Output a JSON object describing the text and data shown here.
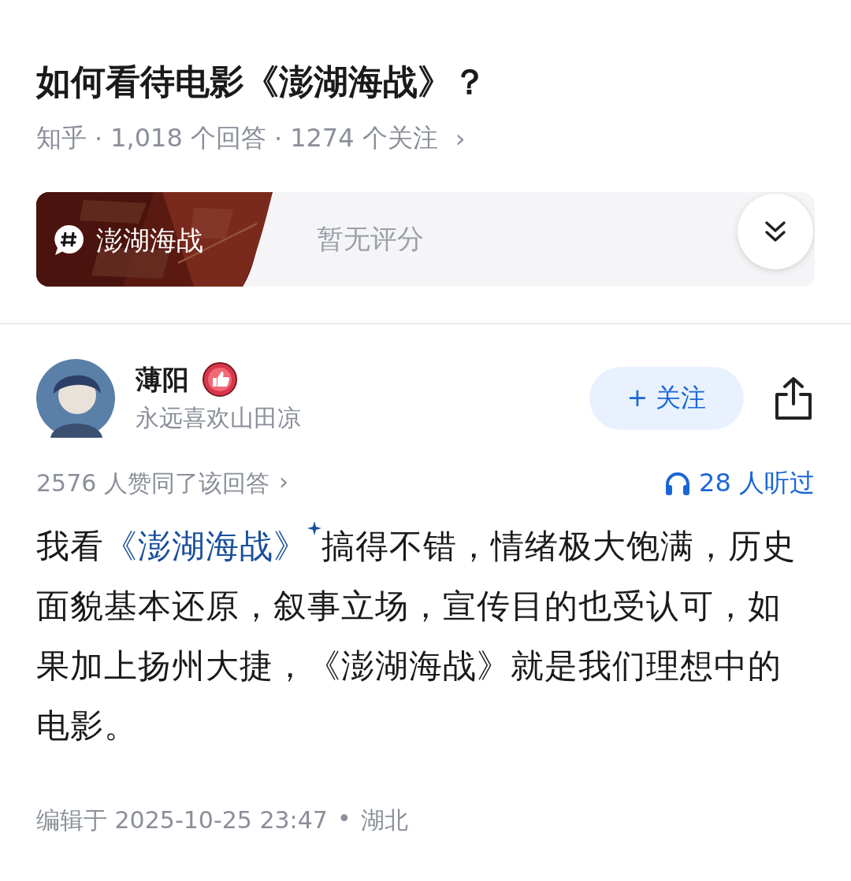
{
  "question": {
    "title": "如何看待电影《澎湖海战》？",
    "source": "知乎",
    "answers": "1,018 个回答",
    "followers": "1274 个关注",
    "chevron": "›",
    "separator": "·"
  },
  "topic_card": {
    "topic": "澎湖海战",
    "rating": "暂无评分"
  },
  "answer": {
    "author": {
      "name": "薄阳",
      "bio": "永远喜欢山田凉"
    },
    "follow_button": "+ 关注",
    "upvotes": "2576 人赞同了该回答",
    "upvotes_chevron": "›",
    "listens": "28 人听过",
    "body": [
      {
        "kind": "text",
        "text": "我看"
      },
      {
        "kind": "link",
        "text": "《澎湖海战》"
      },
      {
        "kind": "text",
        "text": "搞得不错，情绪极大饱满，历史面貌基本还原，叙事立场，宣传目的也受认可，如果加上扬州大捷，《澎湖海战》就是我们理想中的电影。"
      }
    ],
    "edited": "编辑于 2025-10-25 23:47",
    "separator": "•",
    "location": "湖北"
  }
}
